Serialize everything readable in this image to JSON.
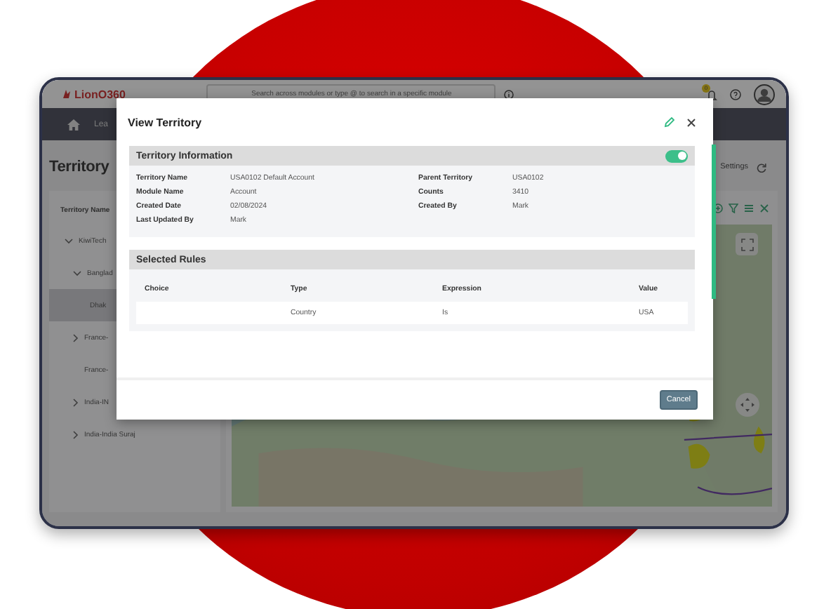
{
  "app": {
    "logo": "LionO360",
    "search": {
      "placeholder": "Search across modules or type @ to search in a specific module"
    },
    "notification_badge": "0",
    "nav_items": [
      {
        "label": "Lea",
        "selected": false
      }
    ],
    "page_title": "Territory",
    "settings_label": "Settings",
    "tree": {
      "column": "Territory Name",
      "items": [
        {
          "label": "KiwiTech",
          "kind": "branch",
          "expanded": true,
          "selected": false,
          "children": [
            {
              "label": "Banglad",
              "kind": "branch",
              "expanded": true,
              "selected": false,
              "children": [
                {
                  "label": "Dhak",
                  "kind": "leaf",
                  "selected": true
                }
              ]
            },
            {
              "label": "France-",
              "kind": "branch",
              "expanded": false,
              "selected": false
            },
            {
              "label": "France-",
              "kind": "leaf",
              "selected": false
            },
            {
              "label": "India-IN",
              "kind": "branch",
              "expanded": false,
              "selected": false
            },
            {
              "label": "India-India Suraj",
              "kind": "branch",
              "expanded": false,
              "selected": false
            }
          ]
        }
      ]
    }
  },
  "modal": {
    "title": "View Territory",
    "info": {
      "title": "Territory Information",
      "active": true,
      "fields": [
        {
          "label": "Territory Name",
          "value": "USA0102 Default Account"
        },
        {
          "label": "Parent Territory",
          "value": "USA0102"
        },
        {
          "label": "Module Name",
          "value": "Account"
        },
        {
          "label": "Counts",
          "value": "3410"
        },
        {
          "label": "Created Date",
          "value": "02/08/2024"
        },
        {
          "label": "Created By",
          "value": "Mark"
        },
        {
          "label": "Last Updated By",
          "value": "Mark"
        }
      ]
    },
    "rules": {
      "title": "Selected Rules",
      "columns": [
        "Choice",
        "Type",
        "Expression",
        "Value"
      ],
      "rows": [
        {
          "type": "Country",
          "expression": "Is",
          "value": "USA"
        }
      ]
    },
    "buttons": [
      "Cancel"
    ]
  }
}
